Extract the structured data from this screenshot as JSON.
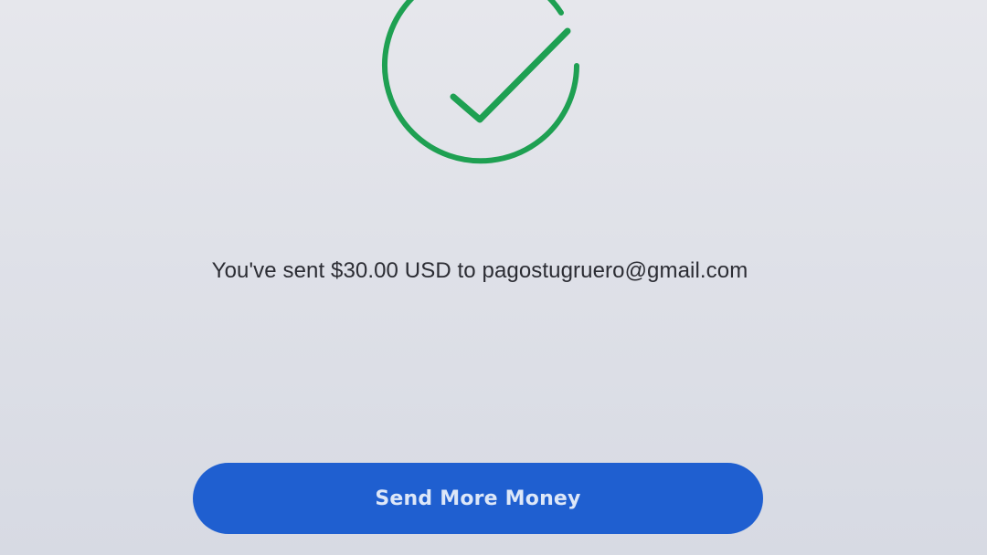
{
  "confirmation": {
    "icon": "check-circle-icon",
    "success_color": "#1ea052",
    "message": "You've sent $30.00 USD to pagostugruero@gmail.com"
  },
  "actions": {
    "send_more_label": "Send More Money",
    "button_color": "#1f5fd0"
  }
}
